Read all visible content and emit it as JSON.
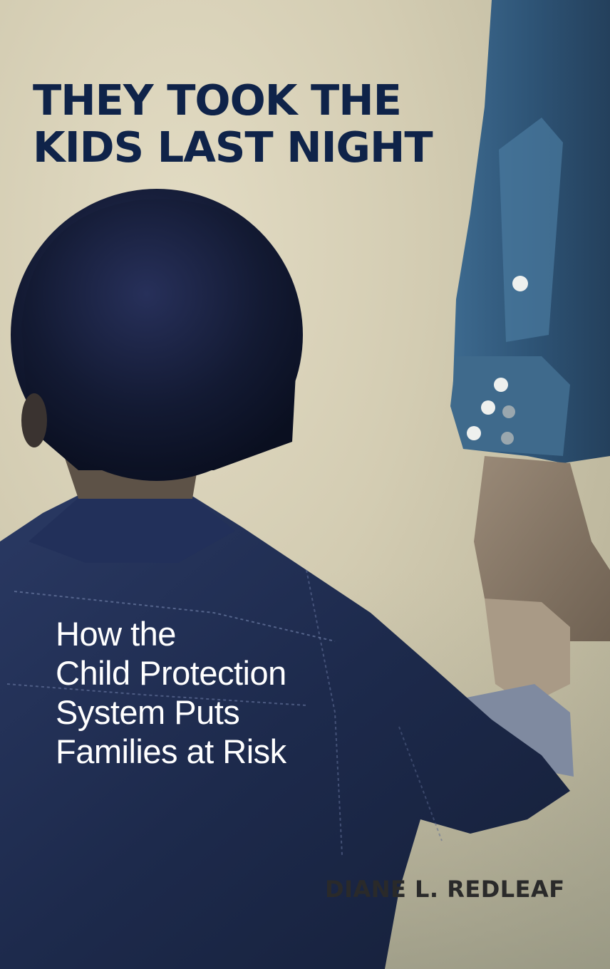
{
  "book": {
    "title_lines": [
      "THEY TOOK THE",
      "KIDS LAST NIGHT"
    ],
    "subtitle_lines": [
      "How the",
      "Child Protection",
      "System Puts",
      "Families at Risk"
    ],
    "author": "DIANE L. REDLEAF"
  },
  "colors": {
    "title": "#0f2349",
    "subtitle": "#ffffff",
    "author": "#2a2a2a",
    "background": "#d3ccb2",
    "denim": "#1d2a4a"
  }
}
